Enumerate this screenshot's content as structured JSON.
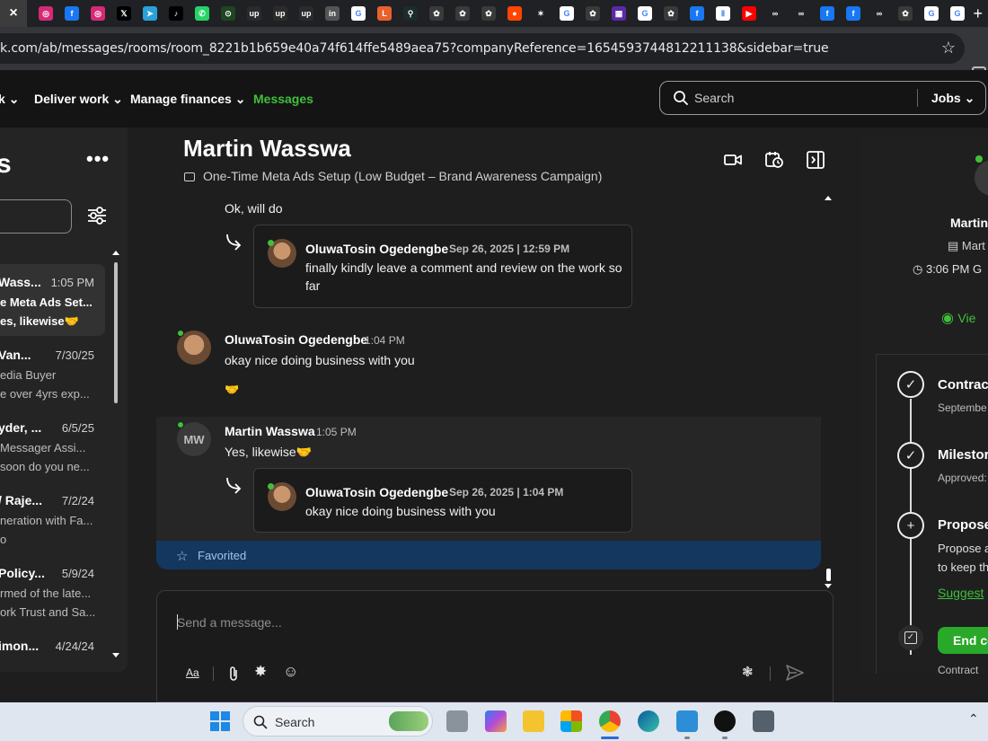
{
  "browser": {
    "tab_close": "×",
    "favicons": [
      {
        "name": "instagram-icon",
        "bg": "#d62976",
        "glyph": "◎"
      },
      {
        "name": "facebook-icon",
        "bg": "#1877f2",
        "glyph": "f"
      },
      {
        "name": "instagram-icon",
        "bg": "#d62976",
        "glyph": "◎"
      },
      {
        "name": "x-icon",
        "bg": "#000000",
        "glyph": "𝕏"
      },
      {
        "name": "telegram-icon",
        "bg": "#2aa1da",
        "glyph": "➤"
      },
      {
        "name": "tiktok-icon",
        "bg": "#000000",
        "glyph": "♪"
      },
      {
        "name": "whatsapp-icon",
        "bg": "#25d366",
        "glyph": "✆"
      },
      {
        "name": "green-app-icon",
        "bg": "#1e4620",
        "glyph": "⊙"
      },
      {
        "name": "upwork-icon",
        "bg": "#2b2b2b",
        "glyph": "up"
      },
      {
        "name": "upwork-icon",
        "bg": "#2b2b2b",
        "glyph": "up"
      },
      {
        "name": "upwork-icon",
        "bg": "#2b2b2b",
        "glyph": "up"
      },
      {
        "name": "linkedin-icon",
        "bg": "#555555",
        "glyph": "in"
      },
      {
        "name": "google-icon",
        "bg": "#ffffff",
        "glyph": "G"
      },
      {
        "name": "orange-app-icon",
        "bg": "#e8612c",
        "glyph": "L"
      },
      {
        "name": "teal-app-icon",
        "bg": "#1c2b2b",
        "glyph": "⚲"
      },
      {
        "name": "chatgpt-icon",
        "bg": "#3a3a3a",
        "glyph": "✿"
      },
      {
        "name": "chatgpt-icon",
        "bg": "#3a3a3a",
        "glyph": "✿"
      },
      {
        "name": "chatgpt-icon",
        "bg": "#3a3a3a",
        "glyph": "✿"
      },
      {
        "name": "reddit-icon",
        "bg": "#ff4500",
        "glyph": "●"
      },
      {
        "name": "spark-icon",
        "bg": "#202124",
        "glyph": "✶"
      },
      {
        "name": "google-icon",
        "bg": "#ffffff",
        "glyph": "G"
      },
      {
        "name": "chatgpt-icon",
        "bg": "#3a3a3a",
        "glyph": "✿"
      },
      {
        "name": "pdf-app-icon",
        "bg": "#5b2aa8",
        "glyph": "▦"
      },
      {
        "name": "google-icon",
        "bg": "#ffffff",
        "glyph": "G"
      },
      {
        "name": "chatgpt-icon",
        "bg": "#3a3a3a",
        "glyph": "✿"
      },
      {
        "name": "facebook-icon",
        "bg": "#1877f2",
        "glyph": "f"
      },
      {
        "name": "pause-app-icon",
        "bg": "#ffffff",
        "glyph": "Ⅱ"
      },
      {
        "name": "youtube-icon",
        "bg": "#ff0000",
        "glyph": "▶"
      },
      {
        "name": "meta-icon",
        "bg": "#202124",
        "glyph": "∞"
      },
      {
        "name": "meta-icon",
        "bg": "#202124",
        "glyph": "∞"
      },
      {
        "name": "facebook-icon",
        "bg": "#1877f2",
        "glyph": "f"
      },
      {
        "name": "facebook-icon",
        "bg": "#1877f2",
        "glyph": "f"
      },
      {
        "name": "meta-icon",
        "bg": "#202124",
        "glyph": "∞"
      },
      {
        "name": "chatgpt-icon",
        "bg": "#3a3a3a",
        "glyph": "✿"
      },
      {
        "name": "google-icon",
        "bg": "#ffffff",
        "glyph": "G"
      },
      {
        "name": "google-icon",
        "bg": "#ffffff",
        "glyph": "G"
      }
    ],
    "new_tab": "+",
    "url": "k.com/ab/messages/rooms/room_8221b1b659e40a74f614ffe5489aea75?companyReference=1654593744812211138&sidebar=true"
  },
  "nav": {
    "items": [
      {
        "label": "k",
        "chevron": "⌄"
      },
      {
        "label": "Deliver work",
        "chevron": "⌄"
      },
      {
        "label": "Manage finances",
        "chevron": "⌄"
      },
      {
        "label": "Messages",
        "chevron": ""
      }
    ],
    "search_placeholder": "Search",
    "search_scope": "Jobs",
    "accent": "#3fc03a"
  },
  "sidebar": {
    "title": "s",
    "more": "•••",
    "conversations": [
      {
        "name": "Wass...",
        "date": "1:05 PM",
        "line1": "e Meta Ads Set...",
        "line2": "es, likewise🤝",
        "selected": true
      },
      {
        "name": "Van...",
        "date": "7/30/25",
        "line1": "edia Buyer",
        "line2": "e over 4yrs exp...",
        "selected": false
      },
      {
        "name": "yder, ...",
        "date": "6/5/25",
        "line1": "Messager Assi...",
        "line2": "soon do you ne...",
        "selected": false
      },
      {
        "name": "/ Raje...",
        "date": "7/2/24",
        "line1": "neration with Fa...",
        "line2": "o",
        "selected": false
      },
      {
        "name": "Policy...",
        "date": "5/9/24",
        "line1": "rmed of the late...",
        "line2": "ork Trust and Sa...",
        "selected": false
      },
      {
        "name": "imon...",
        "date": "4/24/24",
        "line1": "",
        "line2": "",
        "selected": false
      }
    ]
  },
  "chat": {
    "name": "Martin Wasswa",
    "subtitle": "One-Time Meta Ads Setup (Low Budget – Brand Awareness Campaign)",
    "messages": {
      "m1_text": "Ok, will do",
      "q1": {
        "name": "OluwaTosin Ogedengbe",
        "date": "Sep 26, 2025 | 12:59 PM",
        "line1": "finally kindly leave a comment and review on the work so",
        "line2": "far"
      },
      "m2": {
        "name": "OluwaTosin Ogedengbe",
        "time": "1:04 PM",
        "text": "okay nice doing business with you",
        "emoji": "🤝"
      },
      "m3": {
        "name": "Martin Wasswa",
        "time": "1:05 PM",
        "initials": "MW",
        "text": "Yes, likewise🤝"
      },
      "q2": {
        "name": "OluwaTosin Ogedengbe",
        "date": "Sep 26, 2025 | 1:04 PM",
        "line1": "okay nice doing business with you"
      }
    },
    "favorited": "Favorited",
    "composer_placeholder": "Send a message...",
    "composer_tools": {
      "format": "Aa"
    }
  },
  "details": {
    "name": "Martin",
    "company": "Mart",
    "local_time": "3:06 PM G",
    "view_link": "Vie",
    "timeline": [
      {
        "title": "Contrac",
        "sub": "Septembe",
        "icon": "✓"
      },
      {
        "title": "Milestor",
        "sub": "Approved:",
        "icon": "✓"
      },
      {
        "title": "Propose",
        "body1": "Propose a",
        "body2": "to keep th",
        "icon": "+"
      }
    ],
    "suggest_link": "Suggest",
    "end_button": "End co",
    "contract_label": "Contract"
  },
  "taskbar": {
    "search_label": "Search",
    "chevron": "⌃"
  }
}
